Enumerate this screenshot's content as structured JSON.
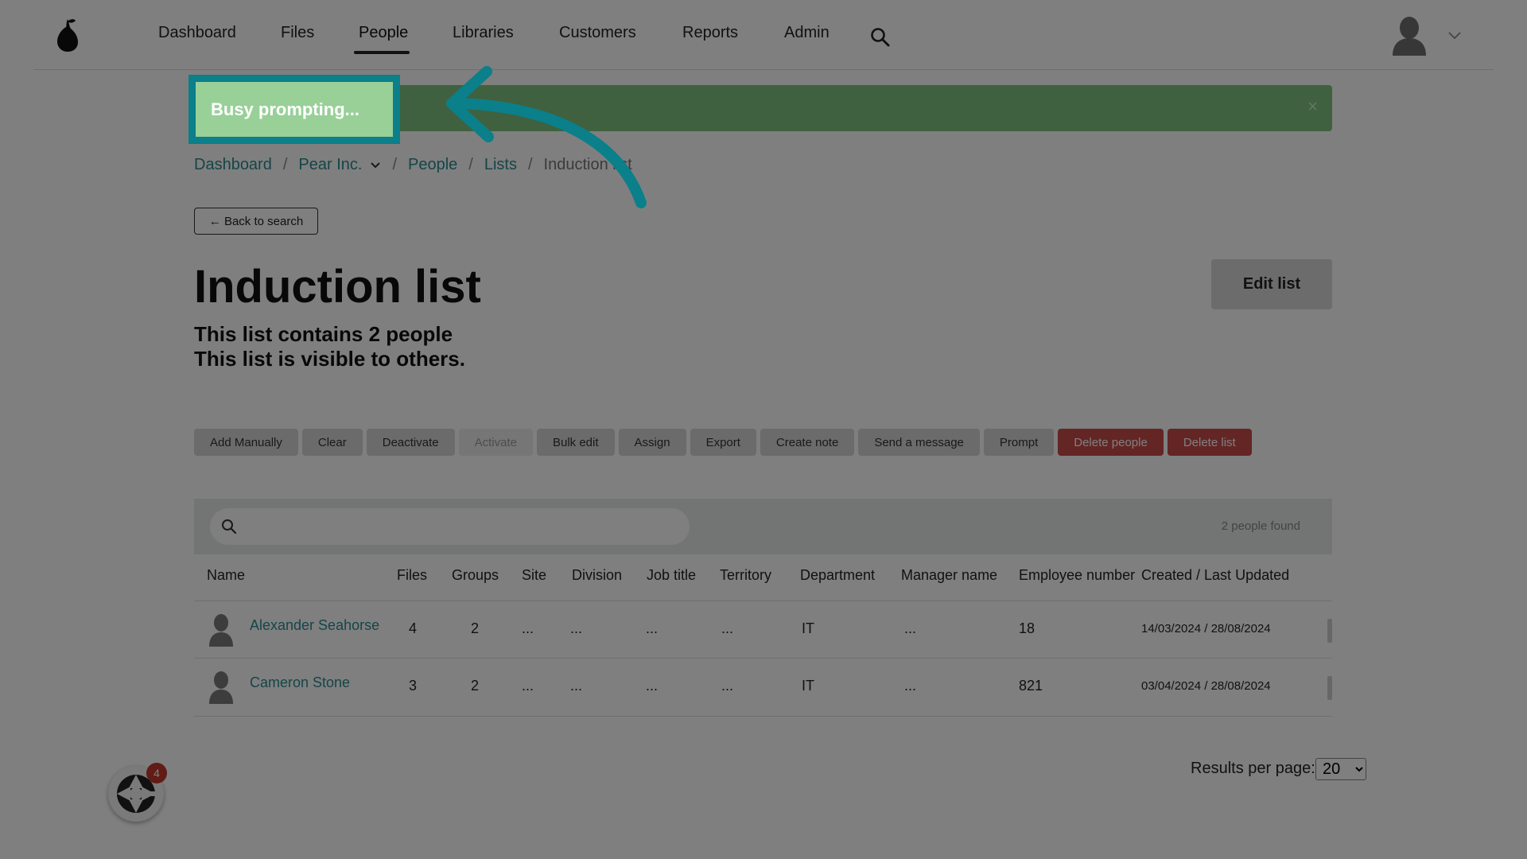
{
  "nav": {
    "items": [
      "Dashboard",
      "Files",
      "People",
      "Libraries",
      "Customers",
      "Reports",
      "Admin"
    ],
    "active": "People",
    "icons": {
      "logo": "pear-logo-icon",
      "search": "search-icon",
      "avatar": "user-avatar-icon",
      "menu": "chevron-down-icon"
    }
  },
  "banner": {
    "text": "Busy prompting...",
    "close": "×",
    "color": "#7ec27e"
  },
  "breadcrumb": {
    "items": [
      "Dashboard",
      "Pear Inc.",
      "People",
      "Lists"
    ],
    "current": "Induction list"
  },
  "back_label": "← Back to search",
  "title": "Induction list",
  "subtitle": {
    "count_line": "This list contains 2 people",
    "visibility_line": "This list is visible to others."
  },
  "edit_label": "Edit list",
  "actions": [
    "Add Manually",
    "Clear",
    "Deactivate",
    "Activate",
    "Bulk edit",
    "Assign",
    "Export",
    "Create note",
    "Send a message",
    "Prompt",
    "Delete people",
    "Delete list"
  ],
  "search": {
    "placeholder": "",
    "count": "2 people found"
  },
  "table": {
    "columns": [
      "Name",
      "Files",
      "Groups",
      "Site",
      "Division",
      "Job title",
      "Territory",
      "Department",
      "Manager name",
      "Employee number",
      "Created / Last Updated"
    ],
    "rows": [
      {
        "name": "Alexander Seahorse",
        "files": "4",
        "groups": "2",
        "site": "...",
        "division": "...",
        "job": "...",
        "territory": "...",
        "department": "IT",
        "manager": "...",
        "employee": "18",
        "dates": "14/03/2024 / 28/08/2024"
      },
      {
        "name": "Cameron Stone",
        "files": "3",
        "groups": "2",
        "site": "...",
        "division": "...",
        "job": "...",
        "territory": "...",
        "department": "IT",
        "manager": "...",
        "employee": "821",
        "dates": "03/04/2024 / 28/08/2024"
      }
    ]
  },
  "pagination": {
    "label": "Results per page:",
    "value": "20"
  },
  "widget": {
    "badge": "4",
    "icon": "chat-widget-icon"
  },
  "highlight": {
    "text": "Busy prompting...",
    "color": "#0b7f8a"
  }
}
